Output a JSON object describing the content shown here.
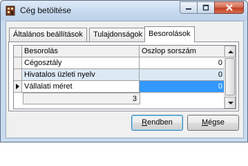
{
  "window": {
    "title": "Cég betöltése",
    "icon": "app-icon"
  },
  "tabs": [
    {
      "label": "Általános beállítások",
      "active": false
    },
    {
      "label": "Tulajdonságok",
      "active": false
    },
    {
      "label": "Besorolások",
      "active": true
    }
  ],
  "grid": {
    "headers": [
      "Besorolás",
      "Oszlop sorszám"
    ],
    "rows": [
      {
        "name": "Cégosztály",
        "column": "0"
      },
      {
        "name": "Hivatalos üzleti nyelv",
        "column": "0"
      },
      {
        "name": "Vállalati méret",
        "column": "0"
      }
    ],
    "footer_value": "3"
  },
  "buttons": {
    "ok_label_pre": "",
    "ok_label_ul": "R",
    "ok_label_post": "endben",
    "cancel_label_pre": "",
    "cancel_label_ul": "M",
    "cancel_label_post": "égse"
  }
}
